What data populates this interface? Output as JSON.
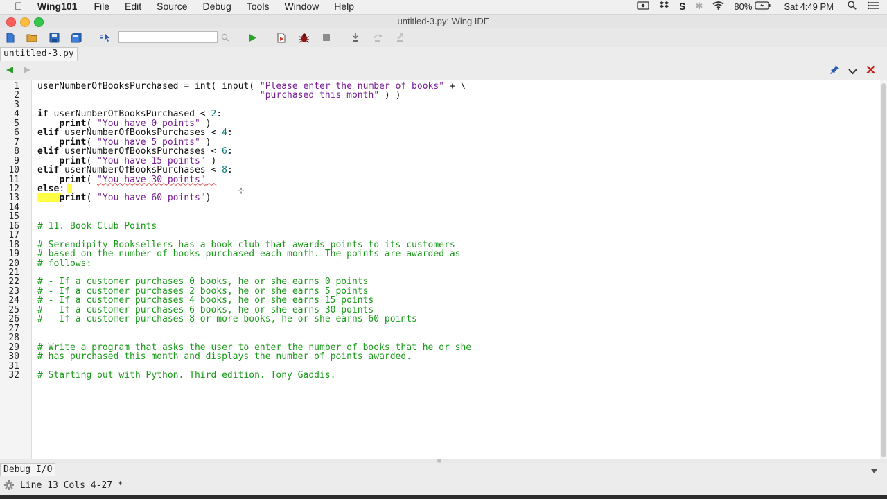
{
  "menubar": {
    "app_name": "Wing101",
    "items": [
      "File",
      "Edit",
      "Source",
      "Debug",
      "Tools",
      "Window",
      "Help"
    ],
    "battery": "80%",
    "clock": "Sat 4:49 PM"
  },
  "window": {
    "title": "untitled-3.py: Wing IDE"
  },
  "toolbar": {
    "search_placeholder": ""
  },
  "editor": {
    "tab_label": "untitled-3.py",
    "lines": [
      {
        "n": "1",
        "html": "userNumberOfBooksPurchased = int( input( <span class='str'>\"Please enter the number of books\"</span> + \\"
      },
      {
        "n": "2",
        "html": "                                         <span class='str'>\"purchased this month\"</span> ) )"
      },
      {
        "n": "3",
        "html": ""
      },
      {
        "n": "4",
        "html": "<span class='kw'>if</span> userNumberOfBooksPurchased &lt; <span class='num'>2</span>:"
      },
      {
        "n": "5",
        "html": "    <span class='kw'>print</span>( <span class='str'>\"You have 0 points\"</span> )"
      },
      {
        "n": "6",
        "html": "<span class='kw'>elif</span> userNumberOfBooksPurchases &lt; <span class='num'>4</span>:"
      },
      {
        "n": "7",
        "html": "    <span class='kw'>print</span>( <span class='str'>\"You have 5 points\"</span> )"
      },
      {
        "n": "8",
        "html": "<span class='kw'>elif</span> userNumberOfBooksPurchases &lt; <span class='num'>6</span>:"
      },
      {
        "n": "9",
        "html": "    <span class='kw'>print</span>( <span class='str'>\"You have 15 points\"</span> )"
      },
      {
        "n": "10",
        "html": "<span class='kw'>elif</span> userNumberOfBooksPurchases &lt; <span class='num'>8</span>:"
      },
      {
        "n": "11",
        "html": "    <span class='kw'>print</span>( <span class='str squig'>\"You have 30 points\"</span><span class='squig'>  </span>"
      },
      {
        "n": "12",
        "html": "<span class='kw'>else</span>:"
      },
      {
        "n": "13",
        "html": "    <span class='kw'>print</span>( <span class='str'>\"You have 60 points\"</span>)"
      },
      {
        "n": "14",
        "html": ""
      },
      {
        "n": "15",
        "html": ""
      },
      {
        "n": "16",
        "html": "<span class='cmt'># 11. Book Club Points</span>"
      },
      {
        "n": "17",
        "html": ""
      },
      {
        "n": "18",
        "html": "<span class='cmt'># Serendipity Booksellers has a book club that awards points to its customers</span>"
      },
      {
        "n": "19",
        "html": "<span class='cmt'># based on the number of books purchased each month. The points are awarded as</span>"
      },
      {
        "n": "20",
        "html": "<span class='cmt'># follows:</span>"
      },
      {
        "n": "21",
        "html": ""
      },
      {
        "n": "22",
        "html": "<span class='cmt'># - If a customer purchases 0 books, he or she earns 0 points</span>"
      },
      {
        "n": "23",
        "html": "<span class='cmt'># - If a customer purchases 2 books, he or she earns 5 points</span>"
      },
      {
        "n": "24",
        "html": "<span class='cmt'># - If a customer purchases 4 books, he or she earns 15 points</span>"
      },
      {
        "n": "25",
        "html": "<span class='cmt'># - If a customer purchases 6 books, he or she earns 30 points</span>"
      },
      {
        "n": "26",
        "html": "<span class='cmt'># - If a customer purchases 8 or more books, he or she earns 60 points</span>"
      },
      {
        "n": "27",
        "html": ""
      },
      {
        "n": "28",
        "html": ""
      },
      {
        "n": "29",
        "html": "<span class='cmt'># Write a program that asks the user to enter the number of books that he or she</span>"
      },
      {
        "n": "30",
        "html": "<span class='cmt'># has purchased this month and displays the number of points awarded.</span>"
      },
      {
        "n": "31",
        "html": ""
      },
      {
        "n": "32",
        "html": "<span class='cmt'># Starting out with Python. Third edition. Tony Gaddis.</span>"
      }
    ]
  },
  "bottom": {
    "debug_tab_label": "Debug I/O",
    "status_text": "Line 13 Cols 4-27 *"
  },
  "colors": {
    "keyword": "#111111",
    "string": "#7a1e96",
    "number": "#0c7a7a",
    "comment": "#1a9a1a",
    "highlight": "#ffff44"
  }
}
